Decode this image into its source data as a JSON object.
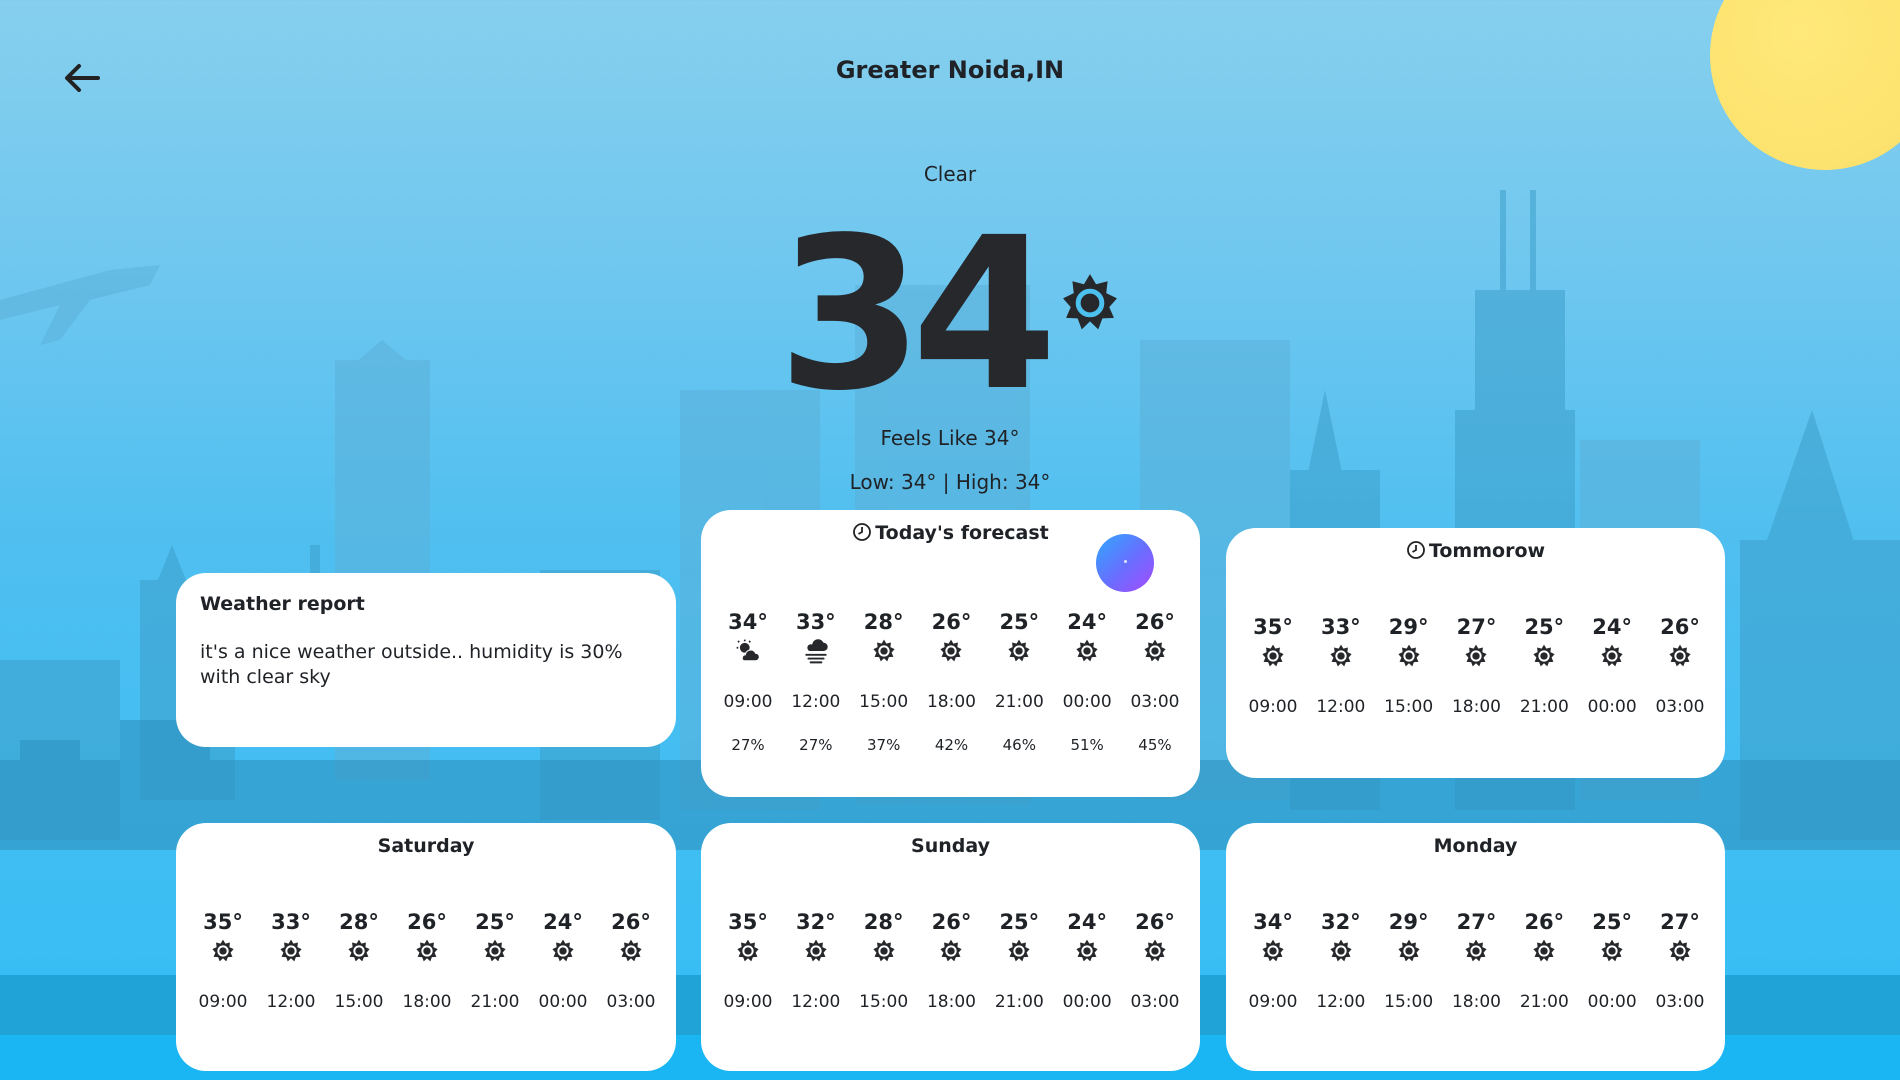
{
  "header": {
    "city": "Greater Noida,IN",
    "condition": "Clear"
  },
  "current": {
    "temp": "34",
    "feels_like": "Feels Like 34°",
    "low_high": "Low: 34° | High: 34°"
  },
  "report": {
    "title": "Weather report",
    "text": "it's a nice weather outside.. humidity is 30% with clear sky"
  },
  "today": {
    "title": "Today's forecast",
    "items": [
      {
        "temp": "34°",
        "time": "09:00",
        "humidity": "27%",
        "icon": "partly-cloudy-icon"
      },
      {
        "temp": "33°",
        "time": "12:00",
        "humidity": "27%",
        "icon": "haze-icon"
      },
      {
        "temp": "28°",
        "time": "15:00",
        "humidity": "37%",
        "icon": "sun-icon"
      },
      {
        "temp": "26°",
        "time": "18:00",
        "humidity": "42%",
        "icon": "sun-icon"
      },
      {
        "temp": "25°",
        "time": "21:00",
        "humidity": "46%",
        "icon": "sun-icon"
      },
      {
        "temp": "24°",
        "time": "00:00",
        "humidity": "51%",
        "icon": "sun-icon"
      },
      {
        "temp": "26°",
        "time": "03:00",
        "humidity": "45%",
        "icon": "sun-icon"
      }
    ]
  },
  "tomorrow": {
    "title": "Tommorow",
    "items": [
      {
        "temp": "35°",
        "time": "09:00",
        "icon": "sun-icon"
      },
      {
        "temp": "33°",
        "time": "12:00",
        "icon": "sun-icon"
      },
      {
        "temp": "29°",
        "time": "15:00",
        "icon": "sun-icon"
      },
      {
        "temp": "27°",
        "time": "18:00",
        "icon": "sun-icon"
      },
      {
        "temp": "25°",
        "time": "21:00",
        "icon": "sun-icon"
      },
      {
        "temp": "24°",
        "time": "00:00",
        "icon": "sun-icon"
      },
      {
        "temp": "26°",
        "time": "03:00",
        "icon": "sun-icon"
      }
    ]
  },
  "saturday": {
    "title": "Saturday",
    "items": [
      {
        "temp": "35°",
        "time": "09:00",
        "icon": "sun-icon"
      },
      {
        "temp": "33°",
        "time": "12:00",
        "icon": "sun-icon"
      },
      {
        "temp": "28°",
        "time": "15:00",
        "icon": "sun-icon"
      },
      {
        "temp": "26°",
        "time": "18:00",
        "icon": "sun-icon"
      },
      {
        "temp": "25°",
        "time": "21:00",
        "icon": "sun-icon"
      },
      {
        "temp": "24°",
        "time": "00:00",
        "icon": "sun-icon"
      },
      {
        "temp": "26°",
        "time": "03:00",
        "icon": "sun-icon"
      }
    ]
  },
  "sunday": {
    "title": "Sunday",
    "items": [
      {
        "temp": "35°",
        "time": "09:00",
        "icon": "sun-icon"
      },
      {
        "temp": "32°",
        "time": "12:00",
        "icon": "sun-icon"
      },
      {
        "temp": "28°",
        "time": "15:00",
        "icon": "sun-icon"
      },
      {
        "temp": "26°",
        "time": "18:00",
        "icon": "sun-icon"
      },
      {
        "temp": "25°",
        "time": "21:00",
        "icon": "sun-icon"
      },
      {
        "temp": "24°",
        "time": "00:00",
        "icon": "sun-icon"
      },
      {
        "temp": "26°",
        "time": "03:00",
        "icon": "sun-icon"
      }
    ]
  },
  "monday": {
    "title": "Monday",
    "items": [
      {
        "temp": "34°",
        "time": "09:00",
        "icon": "sun-icon"
      },
      {
        "temp": "32°",
        "time": "12:00",
        "icon": "sun-icon"
      },
      {
        "temp": "29°",
        "time": "15:00",
        "icon": "sun-icon"
      },
      {
        "temp": "27°",
        "time": "18:00",
        "icon": "sun-icon"
      },
      {
        "temp": "26°",
        "time": "21:00",
        "icon": "sun-icon"
      },
      {
        "temp": "25°",
        "time": "00:00",
        "icon": "sun-icon"
      },
      {
        "temp": "27°",
        "time": "03:00",
        "icon": "sun-icon"
      }
    ]
  },
  "colors": {
    "sky_top": "#86cfee",
    "sky_bottom": "#33bdf5",
    "sun": "#fde36f",
    "card": "#ffffff",
    "text": "#1f2226"
  }
}
